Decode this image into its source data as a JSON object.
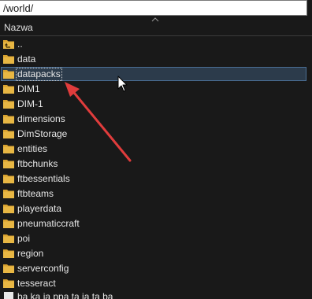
{
  "address_bar": {
    "path": "/world/"
  },
  "columns": {
    "name_header": "Nazwa"
  },
  "colors": {
    "folder": "#e8b744",
    "selection": "#2c3b4b",
    "annotation_arrow": "#e03c3c"
  },
  "items": [
    {
      "label": "..",
      "icon": "folder-up-icon"
    },
    {
      "label": "data",
      "icon": "folder-icon"
    },
    {
      "label": "datapacks",
      "icon": "folder-icon",
      "selected": true
    },
    {
      "label": "DIM1",
      "icon": "folder-icon"
    },
    {
      "label": "DIM-1",
      "icon": "folder-icon"
    },
    {
      "label": "dimensions",
      "icon": "folder-icon"
    },
    {
      "label": "DimStorage",
      "icon": "folder-icon"
    },
    {
      "label": "entities",
      "icon": "folder-icon"
    },
    {
      "label": "ftbchunks",
      "icon": "folder-icon"
    },
    {
      "label": "ftbessentials",
      "icon": "folder-icon"
    },
    {
      "label": "ftbteams",
      "icon": "folder-icon"
    },
    {
      "label": "playerdata",
      "icon": "folder-icon"
    },
    {
      "label": "pneumaticcraft",
      "icon": "folder-icon"
    },
    {
      "label": "poi",
      "icon": "folder-icon"
    },
    {
      "label": "region",
      "icon": "folder-icon"
    },
    {
      "label": "serverconfig",
      "icon": "folder-icon"
    },
    {
      "label": "tesseract",
      "icon": "folder-icon"
    }
  ],
  "bottom_partial": {
    "label": "ba ka ja ppa ta ja ta ba",
    "icon": "file-icon"
  }
}
